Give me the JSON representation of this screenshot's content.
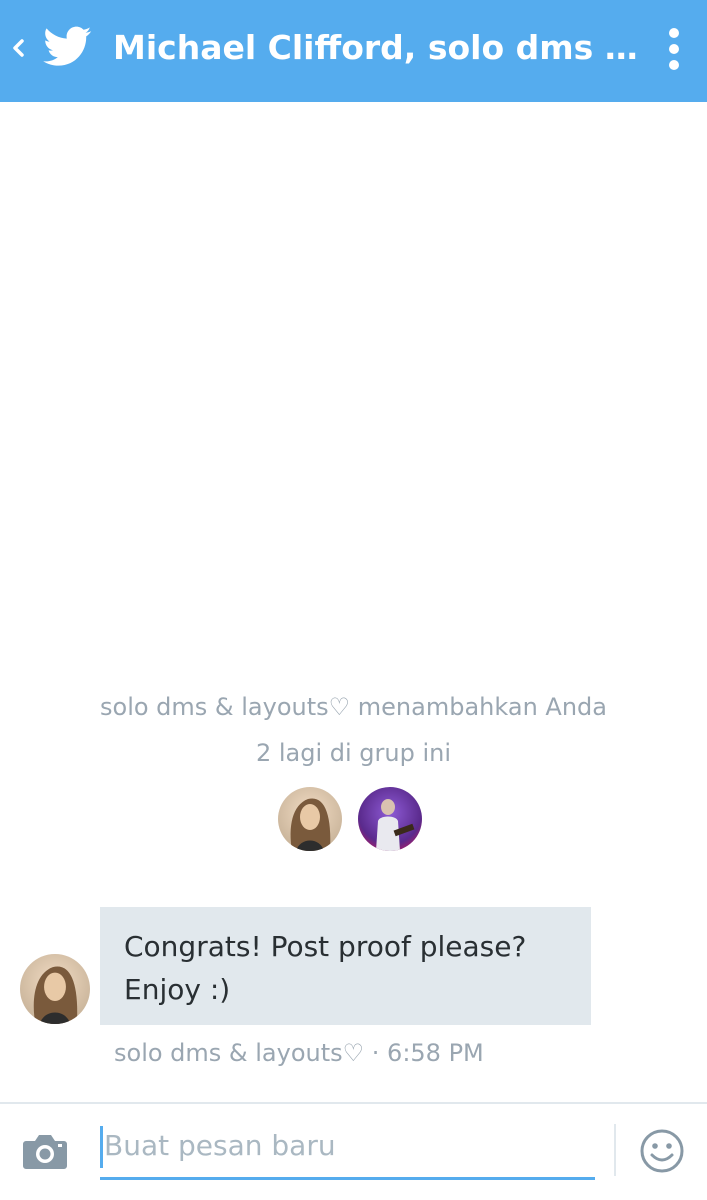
{
  "header": {
    "title": "Michael Clifford, solo dms & layouts♡",
    "background": "#55acee",
    "icons": [
      "chevron-left-icon",
      "twitter-bird-icon",
      "more-vert-icon"
    ]
  },
  "conversation": {
    "event_text": "solo dms & layouts♡ menambahkan Anda",
    "members_text": "2 lagi di grup ini",
    "messages": [
      {
        "text": "Congrats! Post proof please? Enjoy :)",
        "sender": "solo dms & layouts♡",
        "time": "6:58 PM",
        "meta": "solo dms & layouts♡ · 6:58 PM"
      }
    ]
  },
  "composer": {
    "placeholder": "Buat pesan baru",
    "icons": [
      "camera-icon",
      "emoji-icon"
    ]
  },
  "colors": {
    "accent": "#55acee",
    "bubble": "#e1e8ed",
    "muted_text": "#9aa6b1"
  }
}
